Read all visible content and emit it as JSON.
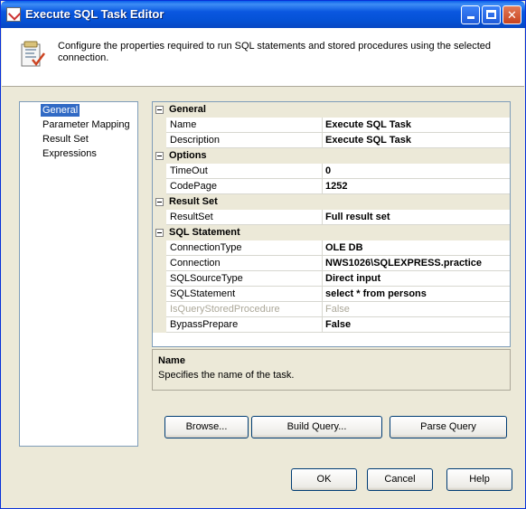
{
  "window": {
    "title": "Execute SQL Task Editor"
  },
  "header": {
    "description": "Configure the properties required to run SQL statements and stored procedures using the selected connection."
  },
  "nav": {
    "items": [
      {
        "label": "General",
        "selected": true
      },
      {
        "label": "Parameter Mapping",
        "selected": false
      },
      {
        "label": "Result Set",
        "selected": false
      },
      {
        "label": "Expressions",
        "selected": false
      }
    ]
  },
  "grid": {
    "categories": [
      {
        "label": "General",
        "rows": [
          {
            "name": "Name",
            "value": "Execute SQL Task"
          },
          {
            "name": "Description",
            "value": "Execute SQL Task"
          }
        ]
      },
      {
        "label": "Options",
        "rows": [
          {
            "name": "TimeOut",
            "value": "0"
          },
          {
            "name": "CodePage",
            "value": "1252"
          }
        ]
      },
      {
        "label": "Result Set",
        "rows": [
          {
            "name": "ResultSet",
            "value": "Full result set"
          }
        ]
      },
      {
        "label": "SQL Statement",
        "rows": [
          {
            "name": "ConnectionType",
            "value": "OLE DB"
          },
          {
            "name": "Connection",
            "value": "NWS1026\\SQLEXPRESS.practice"
          },
          {
            "name": "SQLSourceType",
            "value": "Direct input"
          },
          {
            "name": "SQLStatement",
            "value": "select * from persons"
          },
          {
            "name": "IsQueryStoredProcedure",
            "value": "False",
            "disabled": true
          },
          {
            "name": "BypassPrepare",
            "value": "False"
          }
        ]
      }
    ]
  },
  "description_panel": {
    "title": "Name",
    "text": "Specifies the name of the task."
  },
  "buttons": {
    "browse": "Browse...",
    "build_query": "Build Query...",
    "parse_query": "Parse Query",
    "ok": "OK",
    "cancel": "Cancel",
    "help": "Help"
  },
  "colors": {
    "titlebar": "#0552D6",
    "selection": "#316AC5",
    "dialog_bg": "#ECE9D8"
  }
}
